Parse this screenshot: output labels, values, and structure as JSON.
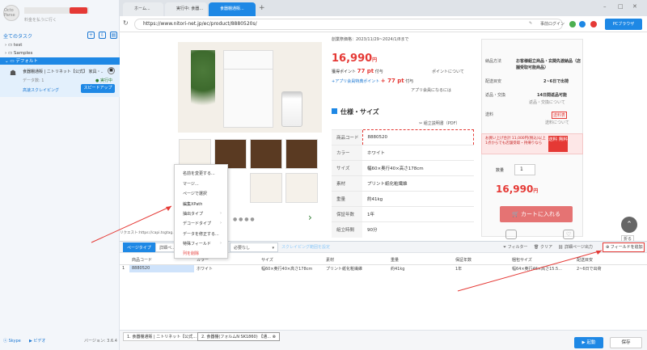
{
  "sidebar": {
    "avatar_text": "Octo Parse",
    "subtitle": "料金を払うに行く",
    "tasks_header": "全てのタスク",
    "tree": [
      "test",
      "Samples",
      "デフォルト"
    ],
    "task": {
      "title": "食器棚通販 | ニトリネット【公式】 家具・...",
      "sub": "データ数: 1",
      "status": "● 実行中",
      "highspeed": "高速スクレイピング",
      "speedup": "スピードアップ"
    },
    "footer": {
      "skype": "Skype",
      "video": "ビデオ",
      "version": "バージョン: 3.6.4"
    }
  },
  "tabs": [
    "ホーム...",
    "実行中: 食器...",
    "食器棚通販..."
  ],
  "address": {
    "url": "https://www.nitori-net.jp/ec/product/8880520s/",
    "login": "事前ログイン",
    "pc_browser": "PCブラウザ"
  },
  "product": {
    "period": "創業祭価格：2023/11/29~2024/1/8まで",
    "price": "16,990",
    "yen": "円",
    "points_label": "獲得ポイント",
    "points": "77 pt",
    "points_suffix": "付与",
    "about_points": "ポイントについて",
    "app_label": "+アプリ会員特典ポイント",
    "app_points": "+ 77 pt",
    "app_suffix": "付与",
    "app_member": "アプリ会員になるには",
    "spec_title": "仕様・サイズ",
    "manual": "組立説明書（PDF）",
    "spec": [
      [
        "商品コード",
        "8880520"
      ],
      [
        "カラー",
        "ホワイト"
      ],
      [
        "サイズ",
        "幅60×奥行40×高さ178cm"
      ],
      [
        "素材",
        "プリント紙化粧繊維"
      ],
      [
        "重量",
        "約41kg"
      ],
      [
        "保証年数",
        "1年"
      ],
      [
        "組立時間",
        "90分"
      ]
    ]
  },
  "rightpanel": {
    "delivery_label": "納品方法",
    "delivery_value": "お客様組立商品・玄関先渡納品（店舗受取可能商品）",
    "est_label": "配送目安",
    "est_value": "2~6日で出荷",
    "return_label": "返品・交換",
    "return_value": "14日間返品可能",
    "return_link": "返品・交換について",
    "shipping_label": "送料",
    "shipping_link": "送料表",
    "shipping_about": "送料について",
    "promo": "お買い上げ合計 11,000円(税込)以上 1点からでも店舗受取・持帰りなら",
    "promo_badge": "送料 無料",
    "qty_label": "数量",
    "qty": "1",
    "price": "16,990",
    "yen": "円",
    "cart": "カートに入れる"
  },
  "context_menu": [
    "名前を変更する...",
    "マージ...",
    "ページで選択",
    "編集XPath",
    "抽出タイプ",
    "デコードタイプ",
    "データを修正する...",
    "特殊フィールド",
    "列を削除"
  ],
  "status_text": "リクエスト:https://capi.tsgtag...",
  "bottom": {
    "tab_page_type": "ページタイプ",
    "tab_detail": "詳細ペ...",
    "select_value": "必要なし",
    "scrape_range": "スクレイピング範囲を設定",
    "filter": "フィルター",
    "clear": "クリア",
    "detail_page_out": "詳細ページ出力",
    "add_field": "フィールドを追加",
    "fold": "折る",
    "headers": [
      "",
      "商品コード",
      "カラー",
      "サイズ",
      "素材",
      "重量",
      "保証年数",
      "梱包サイズ",
      "配送目安"
    ],
    "rows": [
      [
        "1",
        "8880520",
        "ホワイト",
        "幅60×奥行40×高さ178cm",
        "プリント紙化粧繊維",
        "約41kg",
        "1年",
        "幅64×奥行46×高さ15.5...",
        "2~6日で出荷"
      ]
    ]
  },
  "footer": {
    "tab1": "1. 食器棚通販 | ニトリネット【公式...",
    "tab2": "2. 食器棚(フォルムN SK1860) 【通...",
    "start": "▶ 起動",
    "save": "保存"
  }
}
